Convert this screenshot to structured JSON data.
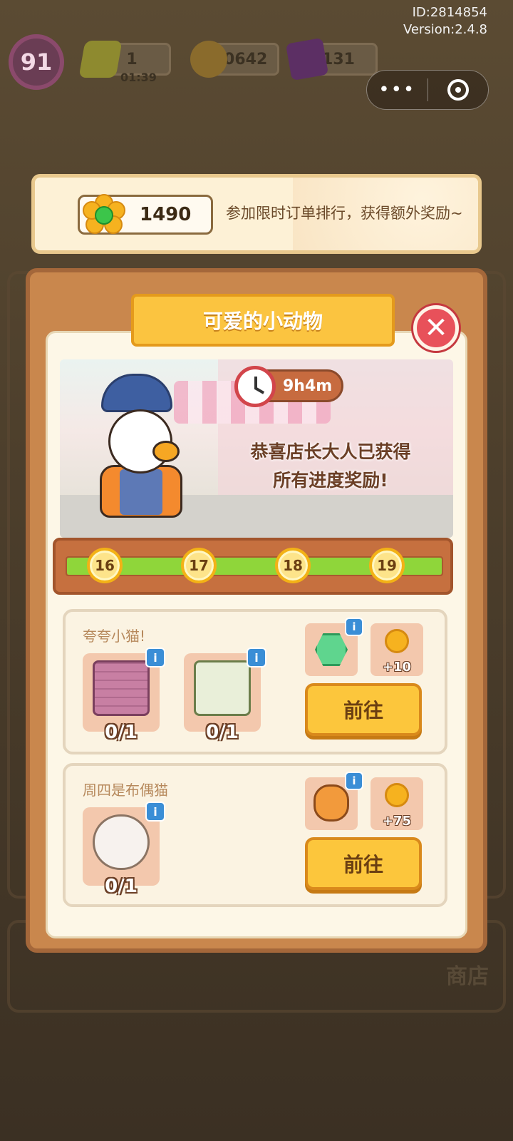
{
  "meta": {
    "id": "ID:2814854",
    "version": "Version:2.4.8"
  },
  "hud": {
    "level": "91",
    "energy": {
      "value": "1",
      "timer": "01:39"
    },
    "coins": "60642",
    "gems": "131"
  },
  "capsule": {
    "more": "•••"
  },
  "event_banner": {
    "flowers": "1490",
    "message": "参加限时订单排行，获得额外奖励~"
  },
  "modal": {
    "title": "可爱的小动物",
    "close": "✕",
    "timer": "9h4m",
    "congrats_line1": "恭喜店长大人已获得",
    "congrats_line2": "所有进度奖励!",
    "progress": {
      "fill_fraction": 1.0,
      "nodes": [
        "16",
        "17",
        "18",
        "19"
      ]
    },
    "tasks": [
      {
        "title": "夸夸小猫!",
        "items": [
          {
            "name": "bricks",
            "count": "0/1",
            "info": "i"
          },
          {
            "name": "book-g1-9",
            "count": "0/1",
            "info": "i"
          }
        ],
        "rewards": [
          {
            "name": "hexagon-8",
            "qty": "",
            "info": "i"
          },
          {
            "name": "flower",
            "qty": "+10",
            "info": ""
          }
        ],
        "go_label": "前往"
      },
      {
        "title": "周四是布偶猫",
        "items": [
          {
            "name": "ragdoll-cat",
            "count": "0/1",
            "info": "i"
          }
        ],
        "rewards": [
          {
            "name": "shiba-dog",
            "qty": "",
            "info": "i"
          },
          {
            "name": "flower",
            "qty": "+75",
            "info": ""
          }
        ],
        "go_label": "前往"
      }
    ]
  },
  "background": {
    "shop_label": "商店"
  }
}
